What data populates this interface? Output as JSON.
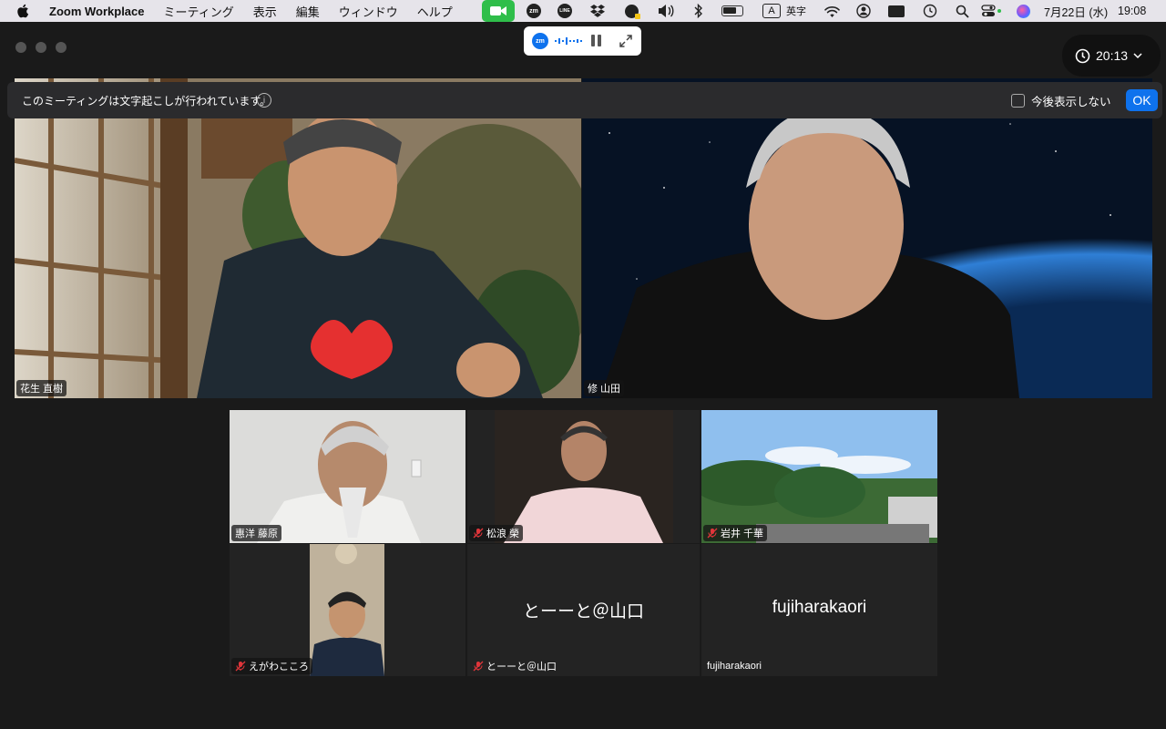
{
  "menubar": {
    "app_name": "Zoom Workplace",
    "menus": [
      "ミーティング",
      "表示",
      "編集",
      "ウィンドウ",
      "ヘルプ"
    ],
    "input_mode_letter": "A",
    "input_mode_label": "英字",
    "date": "7月22日 (水)",
    "time": "19:08",
    "status_icons": [
      "facetime-icon",
      "zoom-icon",
      "line-icon",
      "dropbox-icon",
      "tool-icon",
      "volume-icon",
      "bluetooth-icon",
      "battery-icon",
      "input-source-icon",
      "wifi-icon",
      "user-icon",
      "screen-icon",
      "time-machine-icon",
      "spotlight-icon",
      "control-center-icon",
      "siri-icon"
    ]
  },
  "recording_pill": {
    "logo": "zm"
  },
  "meeting_timer": "20:13",
  "banner": {
    "message": "このミーティングは文字起こしが行われています。",
    "info_glyph": "i",
    "checkbox_label": "今後表示しない",
    "ok_label": "OK"
  },
  "participants": {
    "top_left": {
      "name": "花生 直樹",
      "muted": false
    },
    "top_right": {
      "name": "修 山田",
      "muted": false,
      "active_speaker": true
    },
    "grid": [
      {
        "name": "惠洋 藤原",
        "muted": false
      },
      {
        "name": "松浪 榮",
        "muted": true
      },
      {
        "name": "岩井 千華",
        "muted": true
      },
      {
        "name": "えがわこころ",
        "muted": true
      },
      {
        "name": "とーーと＠山口",
        "muted": true,
        "video_off_display": "とーーと＠山口"
      },
      {
        "name": "fujiharakaori",
        "muted": false,
        "video_off_display": "fujiharakaori"
      }
    ]
  },
  "colors": {
    "active_speaker_border": "#24c94d",
    "ok_button": "#0e72ed",
    "mute_icon": "#e0353a",
    "window_bg": "#1a1a1a"
  }
}
